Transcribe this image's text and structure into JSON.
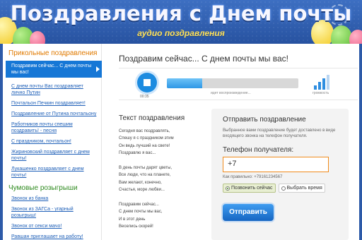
{
  "header": {
    "title": "Поздравления с Днем почты",
    "subtitle": "аудио поздравления"
  },
  "sidebar": {
    "section1_title": "Прикольные поздравления",
    "items": [
      "Поздравим сейчас... С днем почты мы вас!",
      "С днем почты Вас поздравляет лично Путин",
      "Почтальон Печкин поздравляет!",
      "Поздравление от Путина почтальону",
      "Работников почты спешим поздравить! - песня",
      "С праздником, почтальон!",
      "Жириновский поздравляет с днем почты!",
      "Лукашенко поздравляет с днем почты!"
    ],
    "section2_title": "Чумовые розыгрыши",
    "pranks": [
      "Звонок из банка",
      "Звонок из ЗАГСа - угарный розыгрыш!",
      "Звонок от секси мачо!",
      "Равшан приглашает на работу!"
    ]
  },
  "main": {
    "heading": "Поздравим сейчас... С днем почты мы вас!",
    "player": {
      "time": "00:35",
      "status": "идет воспроизведение...",
      "volume_label": "громкость",
      "progress": 0.27
    },
    "text_title": "Текст поздравления",
    "lyrics": [
      "Сегодня вас поздравлять,",
      "Спешу я с праздником этим",
      "Он ведь лучший на свете!",
      "Поздравлю я вас...",
      "",
      "В день почты дарят цветы,",
      "Все люди, что на планете,",
      "Вам желают, конечно,",
      "Счастья, море любви...",
      "",
      "Поздравим сейчас...",
      "С днем почты мы вас,",
      "И в этот день",
      "Веселись скорей!"
    ]
  },
  "send": {
    "title": "Отправить поздравление",
    "description": "Выбранное вами поздравление будет доставлено в виде входящего звонка на телефон получателя.",
    "phone_label": "Телефон получателя:",
    "phone_value": "+7",
    "example": "Как правильно: +79161234567",
    "option_now": "Позвонить сейчас",
    "option_time": "Выбрать время",
    "submit": "Отправить"
  }
}
